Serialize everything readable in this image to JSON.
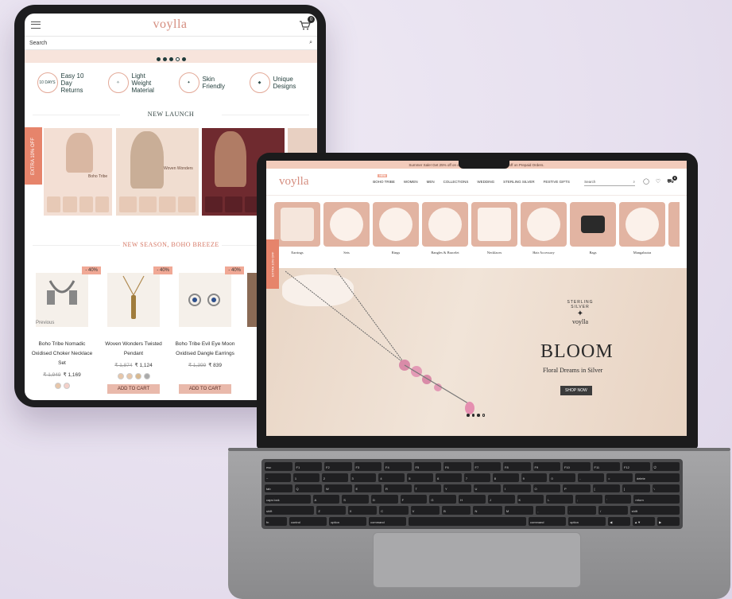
{
  "tablet": {
    "logo": "voylla",
    "cart_count": "0",
    "search_placeholder": "Search",
    "features": [
      {
        "badge": "10 DAYS",
        "label": "Easy 10 Day Returns"
      },
      {
        "badge": "",
        "label": "Light Weight Material"
      },
      {
        "badge": "",
        "label": "Skin Friendly"
      },
      {
        "badge": "",
        "label": "Unique Designs"
      }
    ],
    "new_launch_title": "NEW LAUNCH",
    "offer_tab": "EXTRA 10% OFF",
    "launch_cards": [
      {
        "caption": "Boho Tribe"
      },
      {
        "caption": "Woven Wonders"
      },
      {
        "caption": ""
      }
    ],
    "boho_title": "NEW SEASON, BOHO BREEZE",
    "prev_label": "Previous",
    "products": [
      {
        "discount": "- 40%",
        "name": "Boho Tribe Nomadic Oxidised Choker Necklace Set",
        "old_price": "₹ 1,949",
        "price": "₹ 1,169"
      },
      {
        "discount": "- 40%",
        "name": "Woven Wonders Twisted Pendant",
        "old_price": "₹ 1,874",
        "price": "₹ 1,124"
      },
      {
        "discount": "- 40%",
        "name": "Boho Tribe Evil Eye Moon Oxidised Dangle Earrings",
        "old_price": "₹ 1,399",
        "price": "₹ 839"
      }
    ],
    "add_to_cart": "ADD TO CART"
  },
  "laptop": {
    "promo": "Summer Sale! Get 25% off on order above ... 1,999 • Extra 5% off on Prepaid Orders.",
    "logo": "voylla",
    "nav": [
      {
        "label": "BOHO TRIBE",
        "tag": "NEW"
      },
      {
        "label": "WOMEN",
        "tag": ""
      },
      {
        "label": "MEN",
        "tag": ""
      },
      {
        "label": "COLLECTIONS",
        "tag": ""
      },
      {
        "label": "WEDDING",
        "tag": ""
      },
      {
        "label": "STERLING SILVER",
        "tag": ""
      },
      {
        "label": "FESTIVE GIFTS",
        "tag": ""
      }
    ],
    "search_placeholder": "Search",
    "cart_count": "0",
    "categories": [
      "Earrings",
      "Sets",
      "Rings",
      "Bangles & Bracelet",
      "Necklaces",
      "Hair Accessory",
      "Bags",
      "Mangalsutra"
    ],
    "side_tab": "EXTRA 10% OFF",
    "hero": {
      "badge_arc": "STERLING SILVER",
      "badge_logo": "voylla",
      "title": "BLOOM",
      "subtitle": "Floral Dreams in Silver",
      "cta": "SHOP NOW"
    }
  },
  "keyboard": {
    "rows": [
      [
        "esc",
        "F1",
        "F2",
        "F3",
        "F4",
        "F5",
        "F6",
        "F7",
        "F8",
        "F9",
        "F10",
        "F11",
        "F12",
        "⏻"
      ],
      [
        "~",
        "1",
        "2",
        "3",
        "4",
        "5",
        "6",
        "7",
        "8",
        "9",
        "0",
        "-",
        "=",
        "delete"
      ],
      [
        "tab",
        "Q",
        "W",
        "E",
        "R",
        "T",
        "Y",
        "U",
        "I",
        "O",
        "P",
        "[",
        "]",
        "\\"
      ],
      [
        "caps lock",
        "A",
        "S",
        "D",
        "F",
        "G",
        "H",
        "J",
        "K",
        "L",
        ";",
        "'",
        "return"
      ],
      [
        "shift",
        "Z",
        "X",
        "C",
        "V",
        "B",
        "N",
        "M",
        ",",
        ".",
        "/",
        "shift"
      ],
      [
        "fn",
        "control",
        "option",
        "command",
        "",
        "command",
        "option",
        "◀",
        "▲▼",
        "▶"
      ]
    ]
  }
}
